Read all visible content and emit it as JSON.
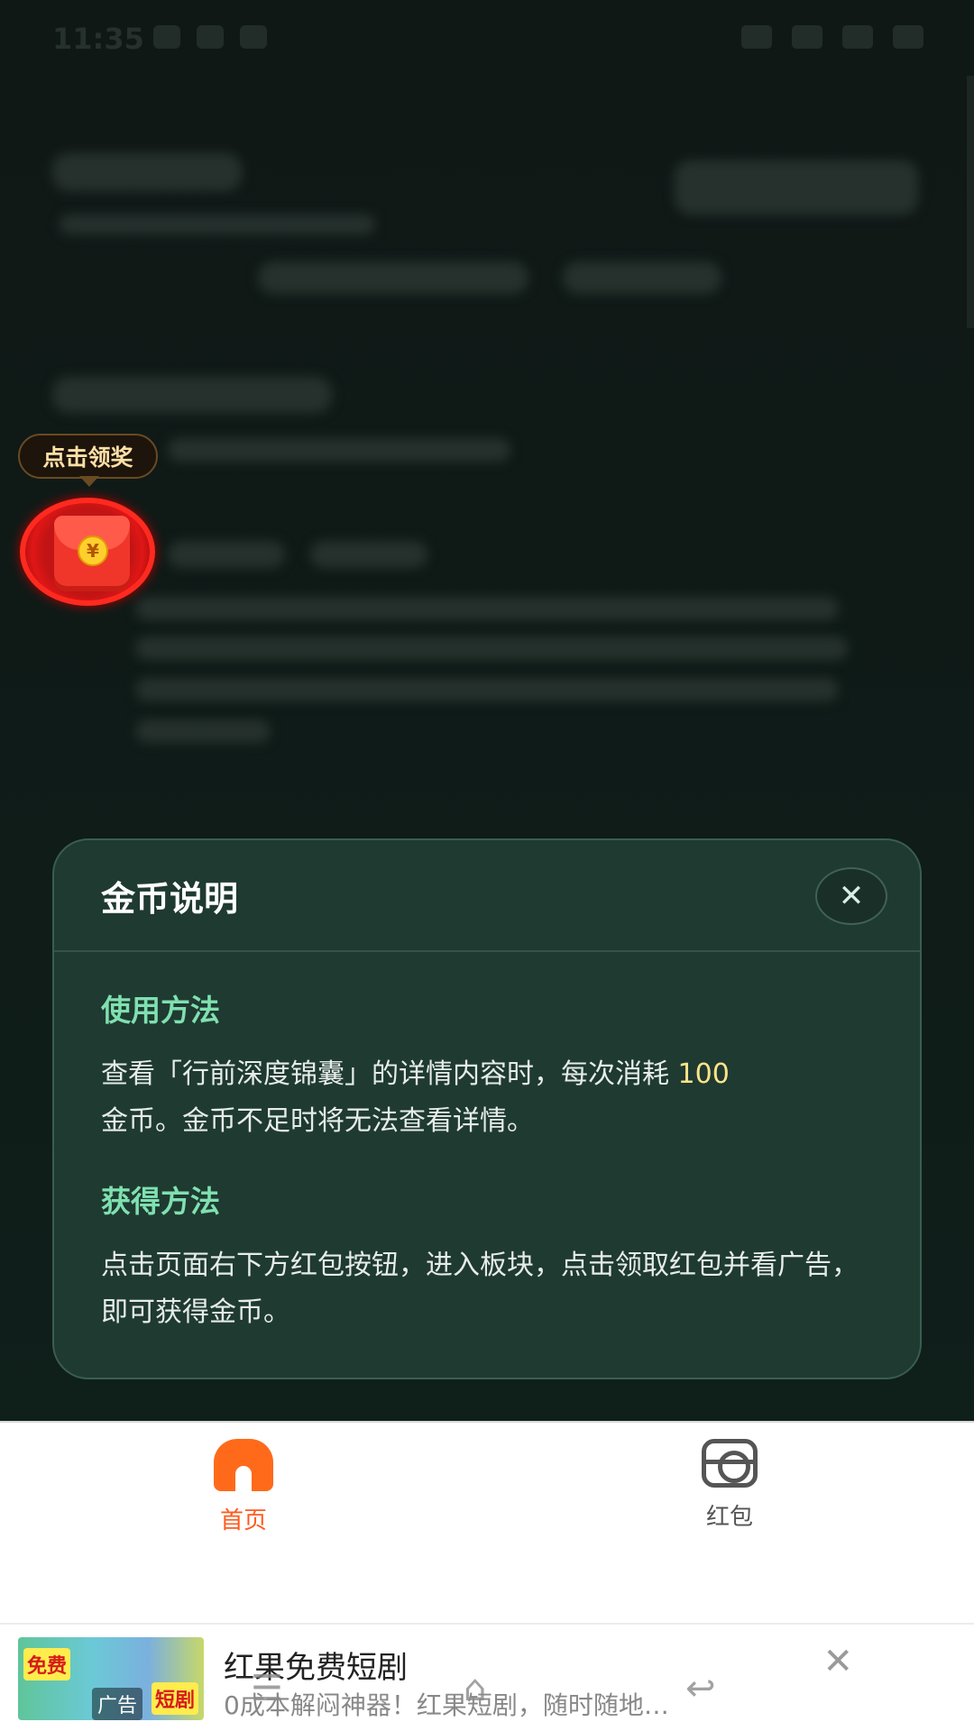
{
  "status_bar": {
    "time": "11:35"
  },
  "floating_reward": {
    "bubble_text": "点击领奖",
    "coin_symbol": "¥"
  },
  "modal": {
    "title": "金币说明",
    "close_symbol": "✕",
    "sections": [
      {
        "heading": "使用方法",
        "text_before": "查看「行前深度锦囊」的详情内容时，每次消耗 ",
        "highlight": "100",
        "text_after": "金币。金币不足时将无法查看详情。"
      },
      {
        "heading": "获得方法",
        "text": "点击页面右下方红包按钮，进入板块，点击领取红包并看广告，即可获得金币。"
      }
    ],
    "colors": {
      "background": "#1f3a31",
      "heading": "#7fe0b0",
      "highlight": "#ffe38a"
    }
  },
  "tabbar": {
    "tabs": [
      {
        "label": "首页",
        "icon": "home-icon",
        "active": true
      },
      {
        "label": "红包",
        "icon": "red-packet-icon",
        "active": false
      }
    ],
    "active_color": "#ff5a1f"
  },
  "ad": {
    "thumb_left_text": "免费",
    "thumb_right_text": "短剧",
    "badge": "广告",
    "title": "红果免费短剧",
    "description": "0成本解闷神器！红果短剧，随时随地…",
    "close_symbol": "✕"
  },
  "system_nav": {
    "menu_symbol": "☰",
    "home_symbol": "⌂",
    "back_symbol": "↩"
  }
}
